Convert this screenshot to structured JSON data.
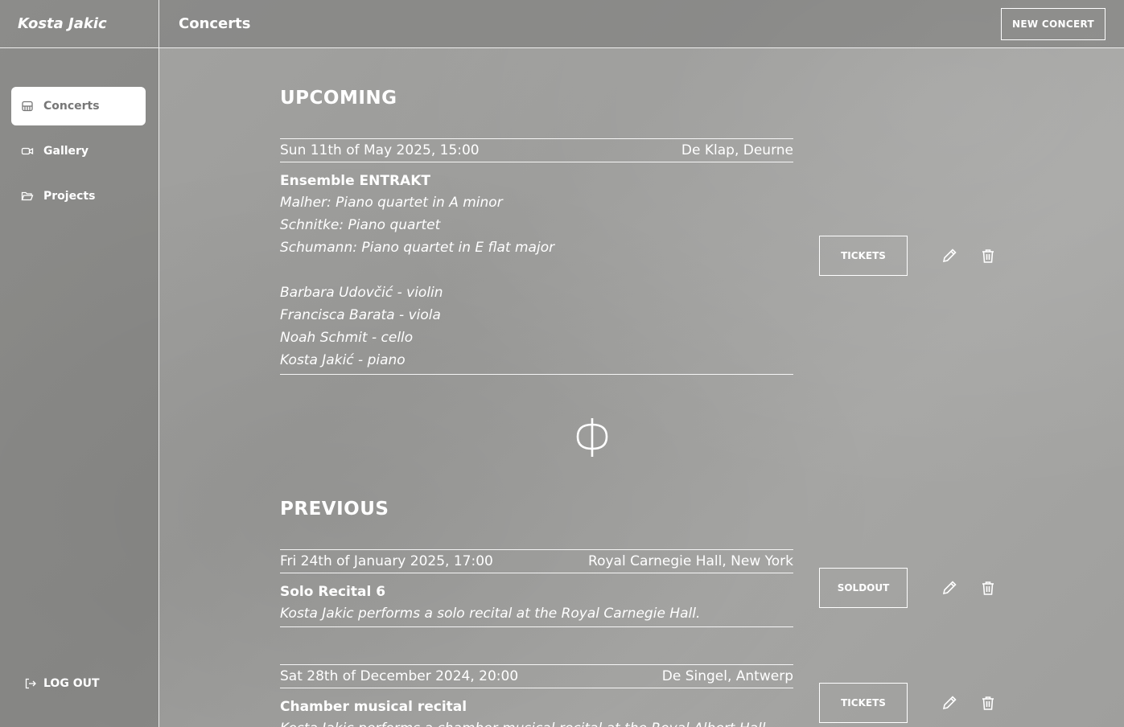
{
  "header": {
    "brand": "Kosta Jakic",
    "page_title": "Concerts",
    "new_concert_label": "NEW CONCERT"
  },
  "sidebar": {
    "items": [
      {
        "label": "Concerts",
        "icon": "piano-icon",
        "active": true
      },
      {
        "label": "Gallery",
        "icon": "video-camera-icon",
        "active": false
      },
      {
        "label": "Projects",
        "icon": "folder-open-icon",
        "active": false
      }
    ],
    "logout_label": "LOG OUT"
  },
  "upcoming": {
    "title": "UPCOMING",
    "concerts": [
      {
        "date": "Sun 11th of May 2025, 15:00",
        "venue": "De Klap, Deurne",
        "title": "Ensemble ENTRAKT",
        "lines": [
          "Malher: Piano quartet in A minor",
          "Schnitke: Piano quartet",
          "Schumann: Piano quartet in E flat major",
          "",
          "Barbara Udovčić - violin",
          "Francisca Barata - viola",
          "Noah Schmit - cello",
          "Kosta Jakić - piano"
        ],
        "action_label": "TICKETS"
      }
    ]
  },
  "previous": {
    "title": "PREVIOUS",
    "concerts": [
      {
        "date": "Fri 24th of January 2025, 17:00",
        "venue": "Royal Carnegie Hall, New York",
        "title": "Solo Recital 6",
        "lines": [
          "Kosta Jakic performs a solo recital at the Royal Carnegie Hall."
        ],
        "action_label": "SOLDOUT"
      },
      {
        "date": "Sat 28th of December 2024, 20:00",
        "venue": "De Singel, Antwerp",
        "title": "Chamber musical recital",
        "lines": [
          "Kosta Jakic performs a chamber musical recital at the Royal Albert Hall."
        ],
        "action_label": "TICKETS"
      }
    ]
  },
  "colors": {
    "background": "#a2a2a0",
    "text": "#ffffff",
    "active_nav_text": "#777777"
  }
}
